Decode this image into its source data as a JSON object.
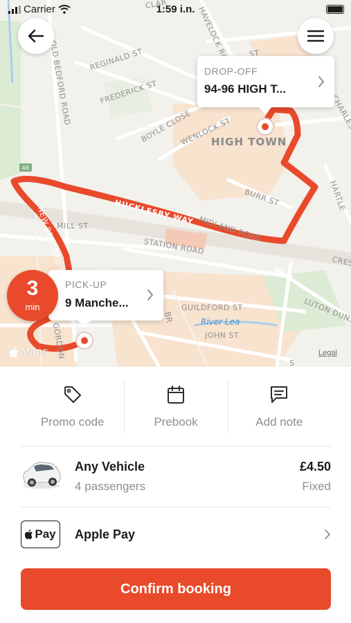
{
  "status_bar": {
    "carrier": "Carrier",
    "time": "1:59 i.n."
  },
  "map": {
    "streets": [
      "OLD BEDFORD ROAD",
      "REGINALD ST",
      "FREDERICK ST",
      "BOYLE CLOSE",
      "WENLOCK ST",
      "HAVELOCK ROAD",
      "BURR ST",
      "MIDLAND ROAD",
      "MILL ST",
      "STATION ROAD",
      "GUILDFORD ST",
      "JOHN ST",
      "LUTON DUNST",
      "CRES",
      "HARTLE",
      "CHARLES",
      "NEW BEDFORD ROAD",
      "A6",
      "ST",
      "CLAR",
      "GORDON",
      "S",
      "BR"
    ],
    "town": "HIGH TOWN",
    "river": "River Lea",
    "route_road": "HUCKLESBY WAY",
    "provider": "Maps",
    "legal": "Legal",
    "colors": {
      "route": "#e84a2b",
      "map_background": "#f3f1ec",
      "urban": "#f8e3cf",
      "park": "#dcebd4"
    }
  },
  "dropoff": {
    "label": "DROP-OFF",
    "address": "94-96 HIGH T..."
  },
  "pickup": {
    "label": "PICK-UP",
    "address": "9 Manche..."
  },
  "eta": {
    "value": "3",
    "unit": "min"
  },
  "actions": [
    {
      "label": "Promo code",
      "icon": "tag-icon"
    },
    {
      "label": "Prebook",
      "icon": "calendar-icon"
    },
    {
      "label": "Add note",
      "icon": "note-icon"
    }
  ],
  "vehicle": {
    "name": "Any Vehicle",
    "passengers": "4 passengers",
    "price": "£4.50",
    "price_type": "Fixed"
  },
  "payment": {
    "badge": "Pay",
    "name": "Apple Pay"
  },
  "confirm_label": "Confirm booking",
  "accent_color": "#e84a2b"
}
